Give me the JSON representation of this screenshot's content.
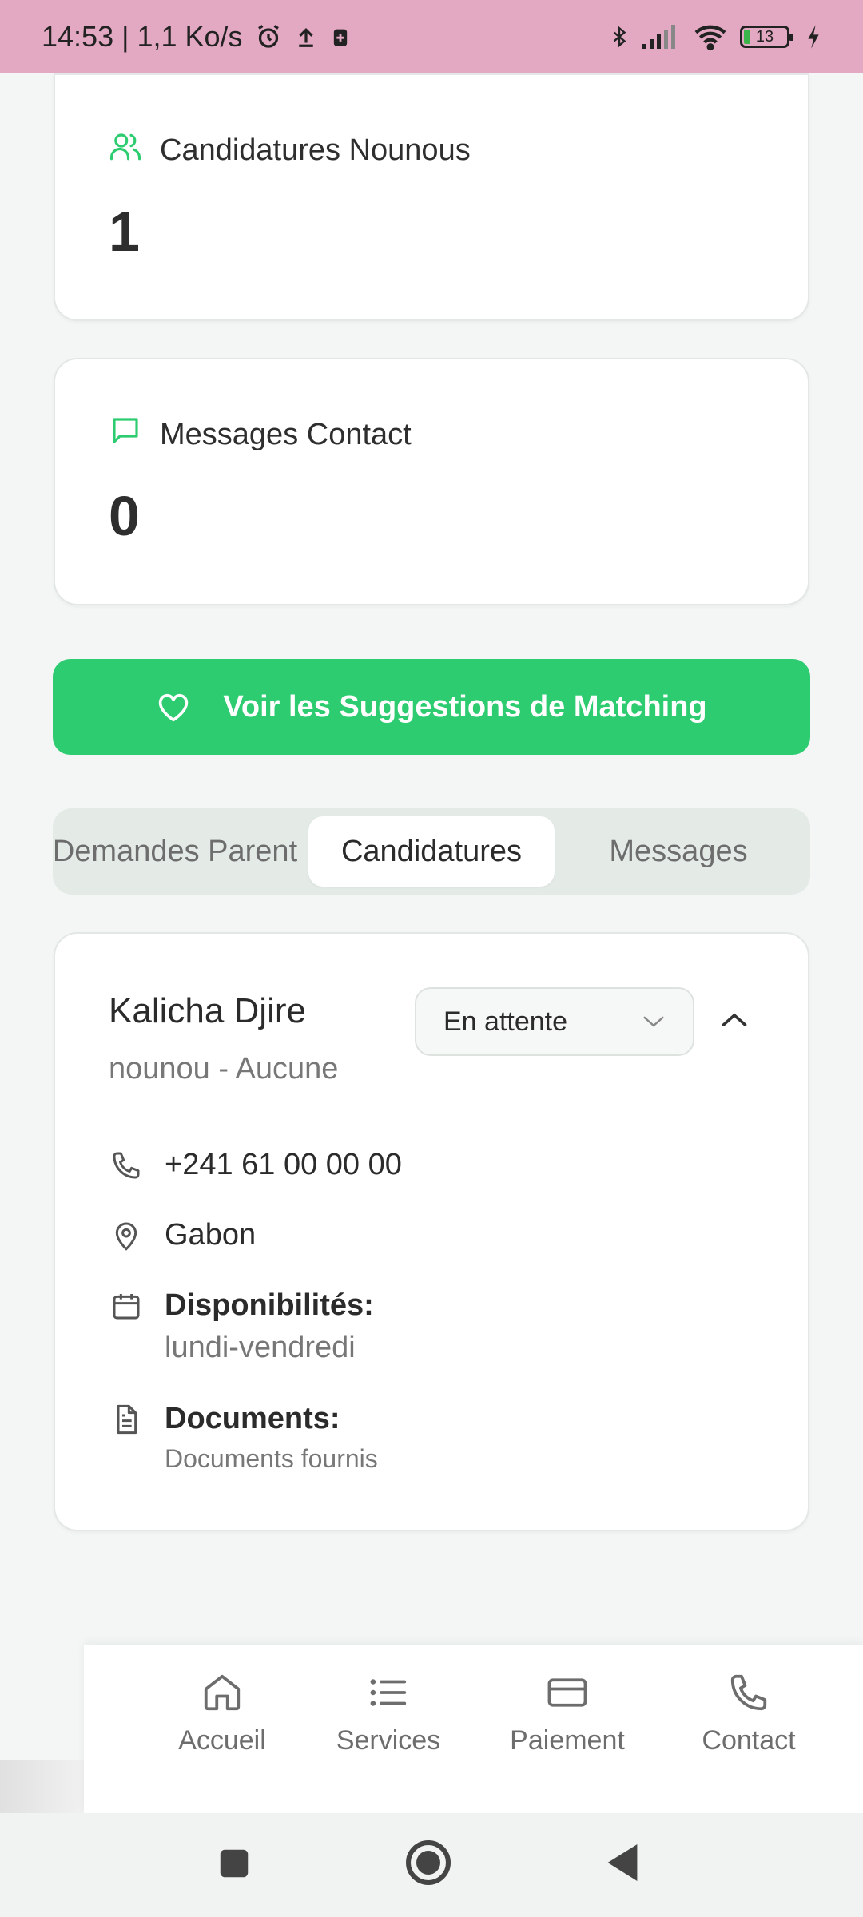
{
  "status_bar": {
    "time_speed": "14:53 | 1,1 Ko/s",
    "battery_level": "13",
    "icons": [
      "alarm-icon",
      "upload-icon",
      "battery-saver-icon",
      "bluetooth-icon",
      "signal-icon",
      "wifi-icon",
      "battery-icon",
      "charging-icon"
    ]
  },
  "stats": {
    "candidatures": {
      "label": "Candidatures Nounous",
      "value": "1",
      "icon": "users-icon"
    },
    "messages": {
      "label": "Messages Contact",
      "value": "0",
      "icon": "message-icon"
    }
  },
  "matching_button": {
    "label": "Voir les Suggestions de Matching",
    "icon": "heart-icon"
  },
  "tabs": [
    {
      "label": "Demandes Parent",
      "active": false
    },
    {
      "label": "Candidatures",
      "active": true
    },
    {
      "label": "Messages",
      "active": false
    }
  ],
  "candidate": {
    "name": "Kalicha Djire",
    "subtitle": "nounou - Aucune",
    "status": "En attente",
    "phone": "+241 61 00 00 00",
    "country": "Gabon",
    "availability_label": "Disponibilités:",
    "availability_value": "lundi-vendredi",
    "documents_label": "Documents:",
    "documents_value": "Documents fournis"
  },
  "bottom_nav": [
    {
      "label": "Accueil",
      "icon": "home-icon"
    },
    {
      "label": "Services",
      "icon": "list-icon"
    },
    {
      "label": "Paiement",
      "icon": "card-icon"
    },
    {
      "label": "Contact",
      "icon": "phone-icon"
    }
  ],
  "colors": {
    "accent": "#2ecc71",
    "status_bar": "#e4a9c2",
    "background": "#f3f6f5"
  }
}
